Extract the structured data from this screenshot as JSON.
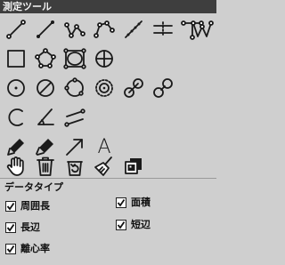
{
  "panel": {
    "title": "測定ツール"
  },
  "data_type": {
    "title": "データタイプ",
    "options": [
      {
        "label": "周囲長",
        "checked": true
      },
      {
        "label": "面積",
        "checked": true
      },
      {
        "label": "長辺",
        "checked": true
      },
      {
        "label": "短辺",
        "checked": true
      },
      {
        "label": "離心率",
        "checked": true
      }
    ]
  }
}
